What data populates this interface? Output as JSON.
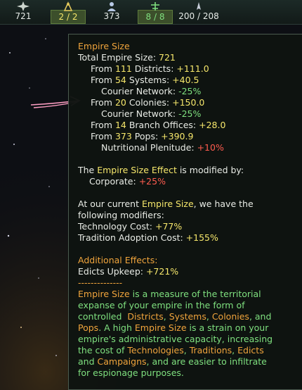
{
  "topbar": {
    "resources": [
      {
        "name": "influence",
        "icon": "star-cross-icon",
        "value": "721"
      },
      {
        "name": "envoys",
        "icon": "envoy-icon",
        "value": "2 / 2"
      },
      {
        "name": "pops",
        "icon": "person-icon",
        "value": "373"
      },
      {
        "name": "edicts",
        "icon": "network-icon",
        "value": "8 / 8"
      },
      {
        "name": "fleet-capacity",
        "icon": "ship-icon",
        "value": "200 / 208"
      }
    ]
  },
  "tooltip": {
    "title": "Empire Size",
    "total_label": "Total Empire Size: ",
    "total_value": "721",
    "lines": {
      "districts_prefix": "From ",
      "districts_count": "111",
      "districts_label": " Districts: ",
      "districts_value": "+111.0",
      "systems_prefix": "From ",
      "systems_count": "54",
      "systems_label": " Systems: ",
      "systems_value": "+40.5",
      "courier1_label": "Courier Network: ",
      "courier1_value": "-25%",
      "colonies_prefix": "From ",
      "colonies_count": "20",
      "colonies_label": " Colonies: ",
      "colonies_value": "+150.0",
      "courier2_label": "Courier Network: ",
      "courier2_value": "-25%",
      "branch_prefix": "From ",
      "branch_count": "14",
      "branch_label": " Branch Offices: ",
      "branch_value": "+28.0",
      "pops_prefix": "From ",
      "pops_count": "373",
      "pops_label": " Pops: ",
      "pops_value": "+390.9",
      "nutritional_label": "Nutritional Plenitude: ",
      "nutritional_value": "+10%"
    },
    "effect": {
      "pre": "The ",
      "name": "Empire Size Effect",
      "post": " is modified by:",
      "corporate_label": "Corporate: ",
      "corporate_value": "+25%"
    },
    "current": {
      "pre": "At our current ",
      "name": "Empire Size",
      "post": ", we have the",
      "line2": "following modifiers:",
      "tech_label": "Technology Cost: ",
      "tech_value": "+77%",
      "tradition_label": "Tradition Adoption Cost: ",
      "tradition_value": "+155%"
    },
    "additional": {
      "title": "Additional Effects:",
      "edicts_label": "Edicts Upkeep: ",
      "edicts_value": "+721%",
      "divider": "--------------"
    },
    "description": {
      "l1_name": "Empire Size",
      "l1_rest": " is a measure of the territorial",
      "l2": "expanse of your empire in the form of",
      "l3_pre": "controlled  ",
      "l3_districts": "Districts",
      "l3_sep1": ", ",
      "l3_systems": "Systems",
      "l3_sep2": ", ",
      "l3_colonies": "Colonies",
      "l3_post": ", and",
      "l4_pops": "Pops",
      "l4_rest": ". A high ",
      "l4_name": "Empire Size",
      "l4_post": " is a strain on your",
      "l5": "empire's administrative capacity, increasing",
      "l6_pre": "the cost of ",
      "l6_tech": "Technologies",
      "l6_sep": ", ",
      "l6_trad": "Traditions",
      "l6_sep2": ", ",
      "l6_edicts": "Edicts",
      "l7_pre": "and ",
      "l7_camp": "Campaigns",
      "l7_post": ", and are easier to infiltrate",
      "l8": "for espionage purposes."
    }
  },
  "annotation": {
    "icon": "pink-arrow-icon",
    "color": "#ff9fc4"
  }
}
